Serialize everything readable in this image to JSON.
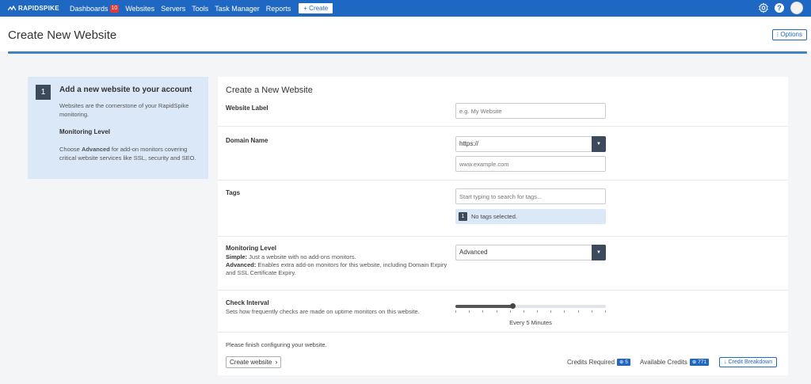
{
  "nav": {
    "brand": "RAPIDSPIKE",
    "items": [
      {
        "label": "Dashboards",
        "badge": "10"
      },
      {
        "label": "Websites"
      },
      {
        "label": "Servers"
      },
      {
        "label": "Tools"
      },
      {
        "label": "Task Manager"
      },
      {
        "label": "Reports"
      }
    ],
    "create_label": "+ Create",
    "icons": [
      "settings-gear-icon",
      "help-icon",
      "user-avatar"
    ]
  },
  "header": {
    "title": "Create New Website",
    "options_label": "⁝ Options"
  },
  "info": {
    "step": "1",
    "title": "Add a new website to your account",
    "text1": "Websites are the cornerstone of your RapidSpike monitoring.",
    "subtitle": "Monitoring Level",
    "text2_pre": "Choose ",
    "text2_bold": "Advanced",
    "text2_post": " for add-on monitors covering critical website services like SSL, security and SEO."
  },
  "form": {
    "title": "Create a New Website",
    "website_label": {
      "label": "Website Label",
      "placeholder": "e.g. My Website",
      "value": ""
    },
    "domain": {
      "label": "Domain Name",
      "protocol": "https://",
      "placeholder": "www.example.com",
      "value": ""
    },
    "tags": {
      "label": "Tags",
      "placeholder": "Start typing to search for tags...",
      "count": "1",
      "notice": "No tags selected."
    },
    "monitoring": {
      "label": "Monitoring Level",
      "simple_title": "Simple:",
      "simple_desc": " Just a website with no add-ons monitors.",
      "advanced_title": "Advanced:",
      "advanced_desc": " Enables extra add-on monitors for this website, including Domain Expiry and SSL Certificate Expiry.",
      "selected": "Advanced"
    },
    "interval": {
      "label": "Check Interval",
      "desc": "Sets how frequently checks are made on uptime monitors on this website.",
      "value_label": "Every 5 Minutes",
      "fraction": 0.38,
      "ticks": 12
    },
    "finish_text": "Please finish configuring your website.",
    "create_label": "Create website",
    "credits_required_label": "Credits Required",
    "credits_required": "⊕ 5",
    "available_credits_label": "Available Credits",
    "available_credits": "⊕ 771",
    "breakdown_label": "↓ Credit Breakdown"
  },
  "colors": {
    "brand": "#1e68c4",
    "panel": "#dbe8f8",
    "dark": "#3d4a5c"
  }
}
